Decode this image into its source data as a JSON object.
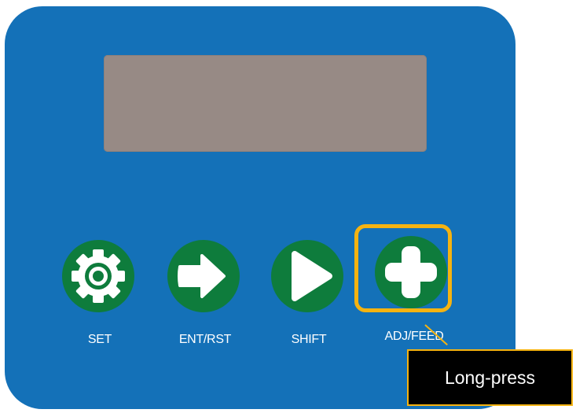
{
  "display": {
    "text": ""
  },
  "buttons": [
    {
      "label": "SET",
      "icon": "gear-icon"
    },
    {
      "label": "ENT/RST",
      "icon": "arrow-right-icon"
    },
    {
      "label": "SHIFT",
      "icon": "play-icon"
    },
    {
      "label": "ADJ/FEED",
      "icon": "plus-icon"
    }
  ],
  "callout": {
    "text": "Long-press"
  },
  "colors": {
    "panel": "#1471b8",
    "lcd": "#978a85",
    "button": "#0e7c3c",
    "highlight": "#f5b311",
    "callout_bg": "#000000"
  }
}
